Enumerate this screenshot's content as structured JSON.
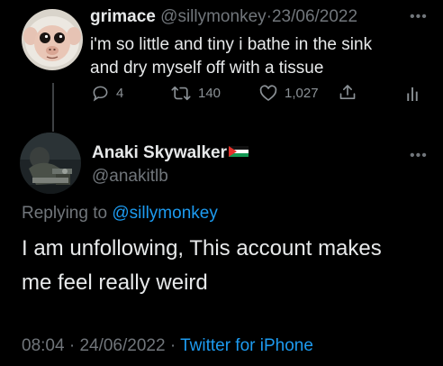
{
  "original_tweet": {
    "display_name": "grimace",
    "handle": "@sillymonkey",
    "separator": "·",
    "date": "23/06/2022",
    "text_line_1": "i'm so little and tiny i bathe in the sink",
    "text_line_2": "and dry myself off with a tissue",
    "replies": "4",
    "retweets": "140",
    "likes": "1,027"
  },
  "reply_tweet": {
    "display_name": "Anaki Skywalker",
    "handle": "@anakitlb",
    "replying_prefix": "Replying to",
    "replying_handle": "@sillymonkey",
    "text_line_1": "I am unfollowing, This account makes",
    "text_line_2": "me feel really weird",
    "time": "08:04",
    "separator_1": "·",
    "date": "24/06/2022",
    "separator_2": "·",
    "source": "Twitter for iPhone"
  },
  "icons": {
    "more_1": "more-horizontal-icon",
    "more_2": "more-horizontal-icon",
    "reply": "reply-bubble-icon",
    "retweet": "retweet-icon",
    "like": "heart-icon",
    "share": "share-icon",
    "analytics": "analytics-icon",
    "flag": "palestine-flag-icon"
  },
  "colors": {
    "background": "#000000",
    "primary_text": "#e7e9ea",
    "muted_text": "#71767b",
    "link": "#1d9bf0"
  }
}
